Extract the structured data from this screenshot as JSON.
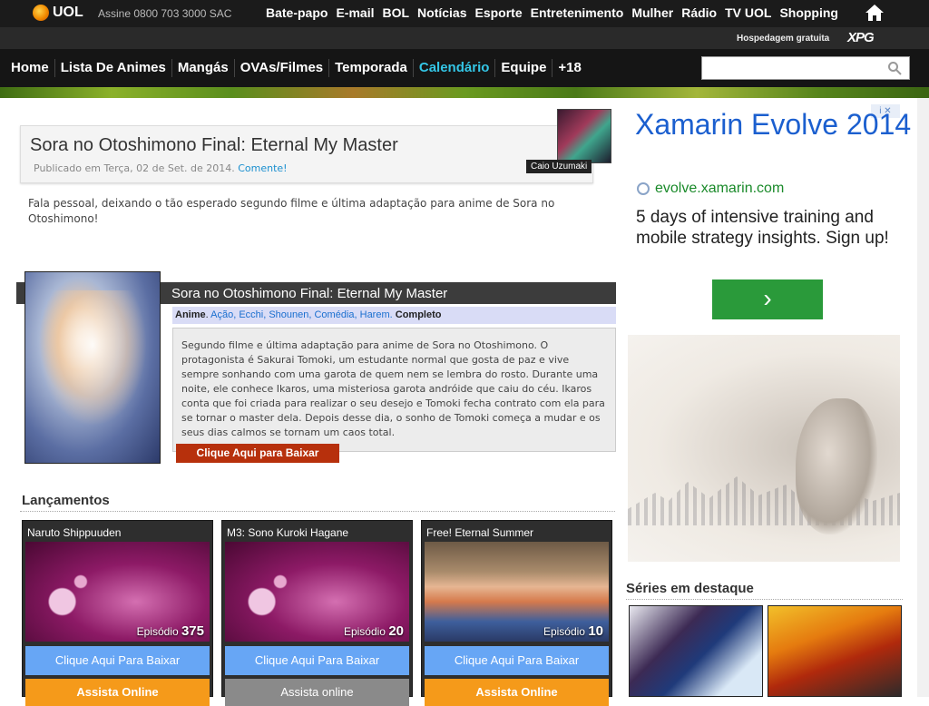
{
  "uol": {
    "logo_text": "UOL",
    "assine": "Assine 0800 703 3000  SAC",
    "links": [
      "Bate-papo",
      "E-mail",
      "BOL",
      "Notícias",
      "Esporte",
      "Entretenimento",
      "Mulher",
      "Rádio",
      "TV UOL",
      "Shopping"
    ],
    "hospedagem": "Hospedagem gratuita",
    "xpg": "XPG"
  },
  "nav": {
    "items": [
      "Home",
      "Lista De Animes",
      "Mangás",
      "OVAs/Filmes",
      "Temporada",
      "Calendário",
      "Equipe",
      "+18"
    ],
    "active": "Calendário",
    "search_placeholder": ""
  },
  "post": {
    "title": "Sora no Otoshimono Final: Eternal My Master",
    "meta": "Publicado em Terça, 02 de Set. de 2014.",
    "comment_link": "Comente!",
    "author": "Caio Uzumaki",
    "intro": "Fala pessoal, deixando o tão esperado segundo filme e última adaptação para anime de Sora no Otoshimono!"
  },
  "anime": {
    "title": "Sora no Otoshimono Final: Eternal My Master",
    "type_label": "Anime",
    "genres": "Ação, Ecchi, Shounen, Comédia, Harem.",
    "status": "Completo",
    "synopsis": "Segundo filme e última adaptação para anime de Sora no Otoshimono. O protagonista é Sakurai Tomoki, um estudante normal que gosta de paz e vive sempre sonhando com uma garota de quem nem se lembra do rosto. Durante uma noite, ele conhece Ikaros, uma misteriosa garota andróide que caiu do céu. Ikaros conta que foi criada para realizar o seu desejo e Tomoki fecha contrato com ela para se tornar o master dela. Depois desse dia, o sonho de Tomoki começa a mudar e os seus dias calmos se tornam um caos total.",
    "download_label": "Clique Aqui para Baixar"
  },
  "lancamentos": {
    "title": "Lançamentos",
    "cards": [
      {
        "name": "Naruto Shippuuden",
        "ep_label": "Episódio",
        "ep": "375",
        "download": "Clique Aqui Para Baixar",
        "online": "Assista Online"
      },
      {
        "name": "M3: Sono Kuroki Hagane",
        "ep_label": "Episódio",
        "ep": "20",
        "download": "Clique Aqui Para Baixar",
        "online": "Assista online"
      },
      {
        "name": "Free! Eternal Summer",
        "ep_label": "Episódio",
        "ep": "10",
        "download": "Clique Aqui Para Baixar",
        "online": "Assista Online"
      }
    ]
  },
  "ad": {
    "title": "Xamarin Evolve 2014",
    "url": "evolve.xamarin.com",
    "desc": "5 days of intensive training and mobile strategy insights. Sign up!",
    "go": "›"
  },
  "series": {
    "title": "Séries em destaque"
  },
  "colors": {
    "nav_active": "#34c6e6",
    "download_btn": "#b7300c",
    "card_btn": "#67a6f5",
    "online_btn": "#f59a1a",
    "ad_link": "#1b5fcf"
  }
}
